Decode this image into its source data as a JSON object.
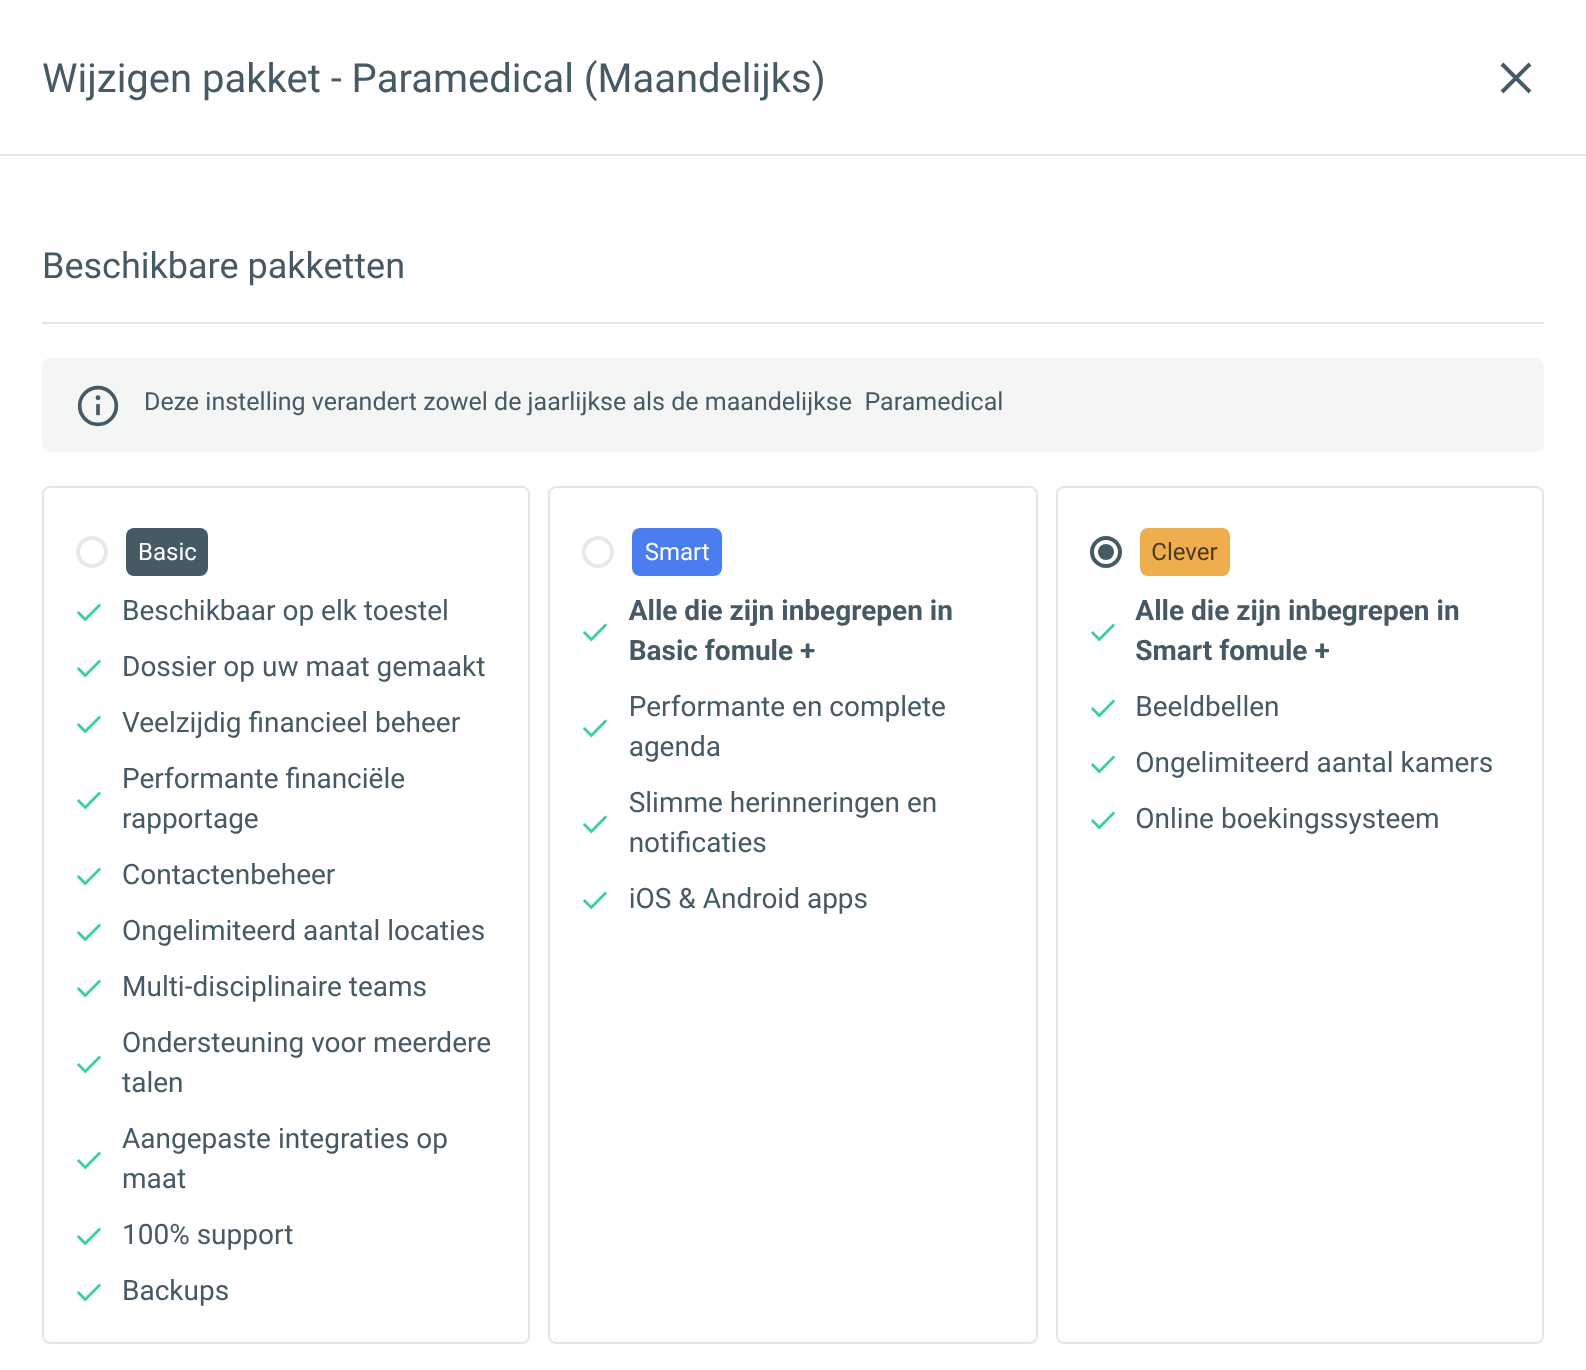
{
  "dialog": {
    "title": "Wijzigen pakket - Paramedical (Maandelijks)"
  },
  "section": {
    "title": "Beschikbare pakketten"
  },
  "info": {
    "text": "Deze instelling verandert zowel de jaarlijkse als de maandelijkse  Paramedical"
  },
  "packages": [
    {
      "name": "Basic",
      "color": "#455a64",
      "selected": false,
      "features": [
        {
          "text": "Beschikbaar op elk toestel",
          "bold": false
        },
        {
          "text": "Dossier op uw maat gemaakt",
          "bold": false
        },
        {
          "text": "Veelzijdig financieel beheer",
          "bold": false
        },
        {
          "text": "Performante financiële rapportage",
          "bold": false
        },
        {
          "text": "Contactenbeheer",
          "bold": false
        },
        {
          "text": "Ongelimiteerd aantal locaties",
          "bold": false
        },
        {
          "text": "Multi-disciplinaire teams",
          "bold": false
        },
        {
          "text": "Ondersteuning voor meerdere talen",
          "bold": false
        },
        {
          "text": "Aangepaste integraties op maat",
          "bold": false
        },
        {
          "text": "100% support",
          "bold": false
        },
        {
          "text": "Backups",
          "bold": false
        }
      ]
    },
    {
      "name": "Smart",
      "color": "#4a7ef0",
      "selected": false,
      "features": [
        {
          "text": "Alle die zijn inbegrepen in Basic fomule +",
          "bold": true
        },
        {
          "text": "Performante en complete agenda",
          "bold": false
        },
        {
          "text": "Slimme herinneringen en notificaties",
          "bold": false
        },
        {
          "text": "iOS & Android apps",
          "bold": false
        }
      ]
    },
    {
      "name": "Clever",
      "color": "#f0ad4e",
      "selected": true,
      "features": [
        {
          "text": "Alle die zijn inbegrepen in Smart fomule +",
          "bold": true
        },
        {
          "text": "Beeldbellen",
          "bold": false
        },
        {
          "text": "Ongelimiteerd aantal kamers",
          "bold": false
        },
        {
          "text": "Online boekingssysteem",
          "bold": false
        }
      ]
    }
  ]
}
